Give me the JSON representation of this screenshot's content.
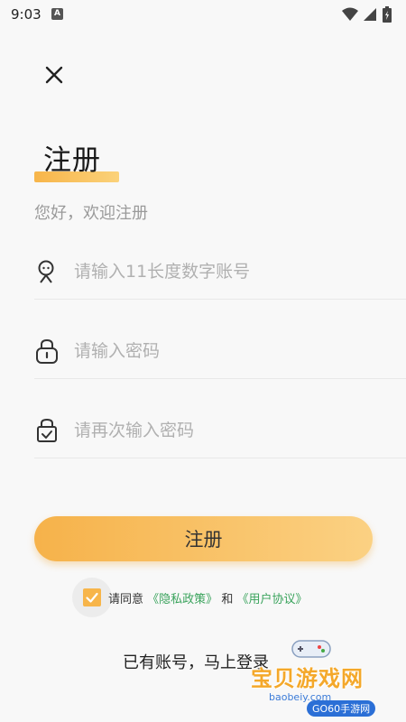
{
  "status": {
    "time": "9:03",
    "app_icon_letter": "A"
  },
  "title": "注册",
  "subtitle": "您好，欢迎注册",
  "fields": {
    "account_placeholder": "请输入11长度数字账号",
    "password_placeholder": "请输入密码",
    "confirm_placeholder": "请再次输入密码"
  },
  "register_label": "注册",
  "agreement": {
    "checked": true,
    "prefix": "请同意",
    "privacy_link": "《隐私政策》",
    "and": "和",
    "user_link": "《用户协议》"
  },
  "login_link": "已有账号，马上登录",
  "watermark": {
    "title": "宝贝游戏网",
    "url": "baobeiy.com",
    "logo": "GO60手游网"
  },
  "colors": {
    "accent": "#f7b54a",
    "link": "#3aa35c",
    "placeholder": "#b0b0b0"
  },
  "icons": [
    "close-icon",
    "user-icon",
    "lock-icon",
    "lock-check-icon",
    "check-icon",
    "wifi-icon",
    "signal-icon",
    "battery-icon"
  ]
}
